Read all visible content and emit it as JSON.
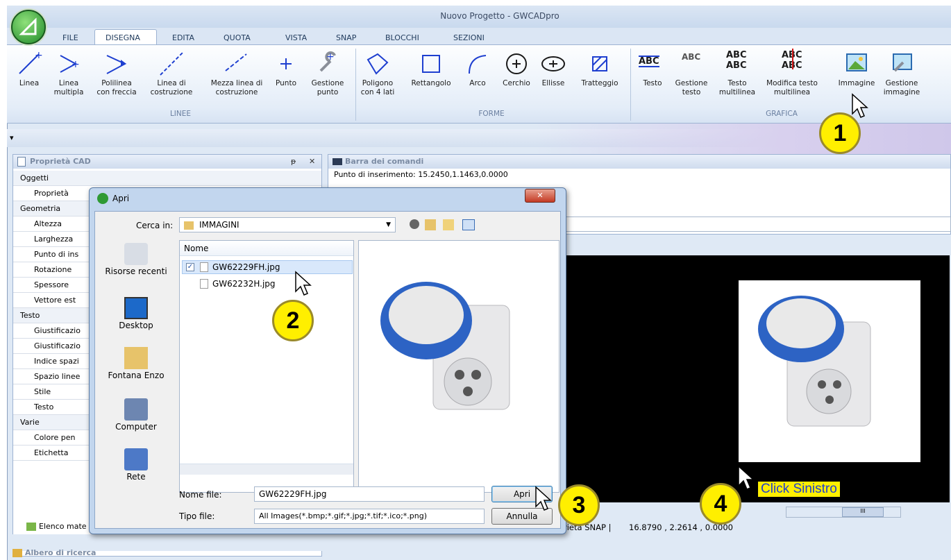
{
  "app": {
    "title": "Nuovo Progetto - GWCADpro"
  },
  "tabs": [
    "FILE",
    "DISEGNA",
    "EDITA",
    "QUOTA",
    "VISTA",
    "SNAP",
    "BLOCCHI",
    "SEZIONI"
  ],
  "ribbon": {
    "linee": {
      "name": "LINEE",
      "buttons": [
        "Linea",
        "Linea\nmultipla",
        "Polilinea\ncon freccia",
        "Linea di\ncostruzione",
        "Mezza linea di\ncostruzione",
        "Punto",
        "Gestione\npunto"
      ]
    },
    "forme": {
      "name": "FORME",
      "buttons": [
        "Poligono\ncon 4 lati",
        "Rettangolo",
        "Arco",
        "Cerchio",
        "Ellisse",
        "Tratteggio"
      ]
    },
    "grafica": {
      "name": "GRAFICA",
      "buttons": [
        "Testo",
        "Gestione\ntesto",
        "Testo\nmultilinea",
        "Modifica testo\nmultilinea",
        "Immagine",
        "Gestione\nimmagine"
      ]
    },
    "icon_text": {
      "abc": "ABC"
    }
  },
  "qat": {
    "arrow": "▾"
  },
  "properties": {
    "title": "Proprietà CAD",
    "pin": "ᵽ",
    "close": "✕",
    "rows": [
      {
        "t": "Oggetti",
        "cat": true
      },
      {
        "t": "Proprietà",
        "cat": false
      },
      {
        "t": "Geometria",
        "cat": true
      },
      {
        "t": "Altezza",
        "cat": false
      },
      {
        "t": "Larghezza",
        "cat": false
      },
      {
        "t": "Punto di ins",
        "cat": false
      },
      {
        "t": "Rotazione",
        "cat": false
      },
      {
        "t": "Spessore",
        "cat": false
      },
      {
        "t": "Vettore est",
        "cat": false
      },
      {
        "t": "Testo",
        "cat": true
      },
      {
        "t": "Giustificazio",
        "cat": false
      },
      {
        "t": "Giustificazio",
        "cat": false
      },
      {
        "t": "Indice spazi",
        "cat": false
      },
      {
        "t": "Spazio linee",
        "cat": false
      },
      {
        "t": "Stile",
        "cat": false
      },
      {
        "t": "Testo",
        "cat": false
      },
      {
        "t": "Varie",
        "cat": true
      },
      {
        "t": "Colore pen",
        "cat": false
      },
      {
        "t": "Etichetta",
        "cat": false
      }
    ]
  },
  "commands": {
    "title": "Barra dei comandi",
    "line1": "Punto di inserimento: 15.2450,1.1463,0.0000"
  },
  "status": {
    "snap": "rietà SNAP |",
    "coords": "16.8790 , 2.2614 , 0.0000"
  },
  "bottom": {
    "elenco": "Elenco mate",
    "albero": "Albero di ricerca"
  },
  "dialog": {
    "title": "Apri",
    "close": "✕",
    "cerca_label": "Cerca in:",
    "folder": "IMMAGINI",
    "column": "Nome",
    "files": [
      "GW62229FH.jpg",
      "GW62232H.jpg"
    ],
    "places": [
      "Risorse recenti",
      "Desktop",
      "Fontana Enzo",
      "Computer",
      "Rete"
    ],
    "nome_file_label": "Nome file:",
    "nome_file_value": "GW62229FH.jpg",
    "tipo_file_label": "Tipo file:",
    "tipo_file_value": "All Images(*.bmp;*.gif;*.jpg;*.tif;*.ico;*.png)",
    "open": "Apri",
    "cancel": "Annulla",
    "scroll_thumb": "III"
  },
  "annotations": {
    "step1": "1",
    "step2": "2",
    "step3": "3",
    "step4": "4",
    "click": "Click Sinistro"
  },
  "colors": {
    "ribbon_blue": "#1e3fd0",
    "callout_yellow": "#ffef00",
    "canvas": "#000000"
  }
}
